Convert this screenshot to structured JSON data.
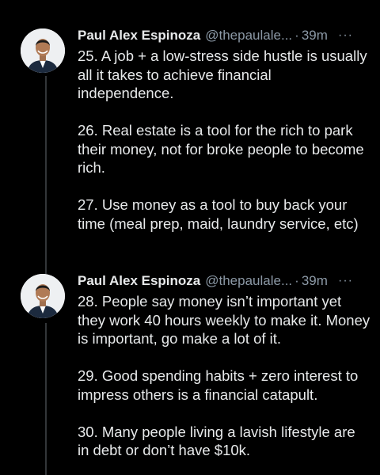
{
  "tweets": [
    {
      "author": "Paul Alex Espinoza",
      "handle": "@thepaulale...",
      "separator": "·",
      "time": "39m",
      "more_icon": "···",
      "paragraphs": [
        "25. A job + a low-stress side hustle is usually all it takes to achieve financial independence.",
        "26. Real estate is a tool for the rich to park their money, not for broke people to become rich.",
        "27. Use money as a tool to buy back your time (meal prep, maid, laundry service, etc)"
      ]
    },
    {
      "author": "Paul Alex Espinoza",
      "handle": "@thepaulale...",
      "separator": "·",
      "time": "39m",
      "more_icon": "···",
      "paragraphs": [
        "28. People say money isn’t important yet they work 40 hours weekly to make it. Money is important, go make a lot of it.",
        "29. Good spending habits + zero interest to impress others is a financial catapult.",
        "30. Many people living a lavish lifestyle are in debt or don’t have $10k."
      ]
    }
  ],
  "colors": {
    "background": "#000000",
    "text": "#e7e9ea",
    "secondary": "#8b98a5",
    "thread_line": "#333639"
  }
}
